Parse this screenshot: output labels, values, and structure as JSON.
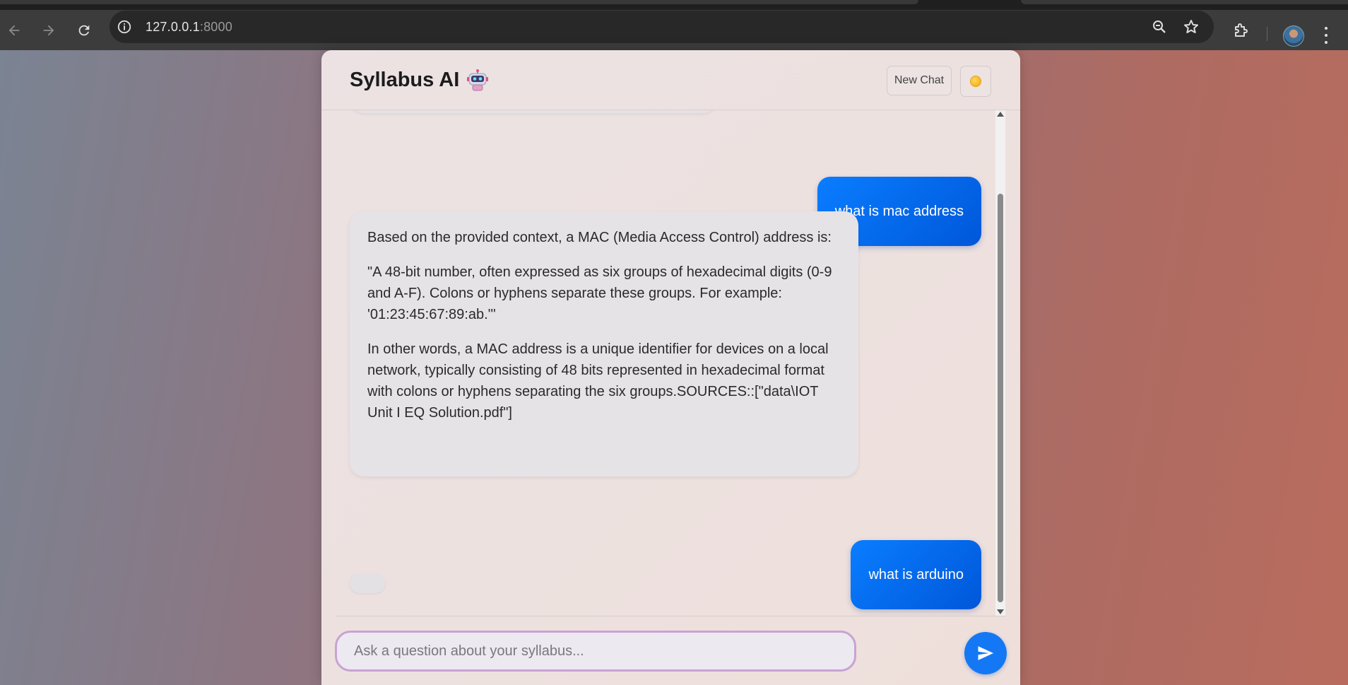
{
  "browser": {
    "url_host": "127.0.0.1",
    "url_port": ":8000"
  },
  "app": {
    "title": "Syllabus AI",
    "new_chat_label": "New Chat"
  },
  "messages": {
    "user_1": "what is mac address",
    "bot_1": [
      "Based on the provided context, a MAC (Media Access Control) address is:",
      "\"A 48-bit number, often expressed as six groups of hexadecimal digits (0-9 and A-F). Colons or hyphens separate these groups. For example: '01:23:45:67:89:ab.'\"",
      "In other words, a MAC address is a unique identifier for devices on a local network, typically consisting of 48 bits represented in hexadecimal format with colons or hyphens separating the six groups.SOURCES::[\"data\\IOT Unit I EQ Solution.pdf\"]"
    ],
    "user_2": "what is arduino"
  },
  "composer": {
    "placeholder": "Ask a question about your syllabus..."
  },
  "icons": {
    "back": "arrow-left-icon",
    "forward": "arrow-right-icon",
    "reload": "reload-icon",
    "info": "info-icon",
    "zoom": "zoom-icon",
    "bookmark": "star-icon",
    "extensions": "puzzle-icon",
    "menu": "kebab-menu-icon",
    "title_emoji": "robot-icon",
    "theme": "sun-icon",
    "send": "send-icon"
  },
  "colors": {
    "user_bubble": "#0a7dff",
    "bot_bubble": "#e6e3e7",
    "send_button": "#1478f5",
    "input_border": "#c9a2d4"
  }
}
